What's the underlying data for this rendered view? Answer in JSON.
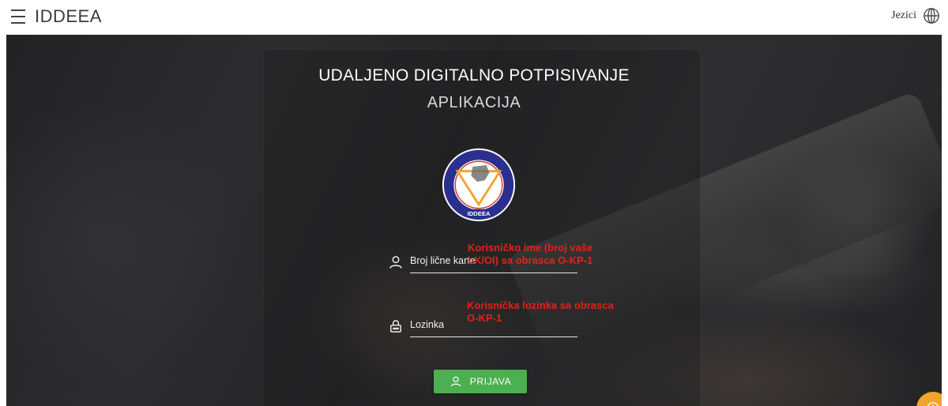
{
  "header": {
    "brand": "IDDEEA",
    "language_label": "Jezici",
    "menu_icon": "hamburger-icon",
    "language_icon": "globe-icon"
  },
  "main": {
    "title": "UDALJENO DIGITALNO POTPISIVANJE",
    "subtitle": "APLIKACIJA",
    "logo_text": "IDDEEA"
  },
  "form": {
    "username": {
      "placeholder": "Broj lične karte",
      "value": "",
      "icon": "user-icon",
      "annotation": "Korisničko ime (broj vaše LK/OI) sa obrasca O-KP-1"
    },
    "password": {
      "placeholder": "Lozinka",
      "value": "",
      "icon": "lock-icon",
      "annotation": "Korisnička lozinka sa obrasca O-KP-1"
    },
    "login_button": {
      "label": "PRIJAVA",
      "icon": "user-icon"
    }
  },
  "info_button": {
    "icon": "info-icon"
  },
  "colors": {
    "accent_green": "#4caf50",
    "fab_orange": "#f0a52a",
    "annotation_red": "#e2231a",
    "logo_blue": "#2b2f8f"
  }
}
